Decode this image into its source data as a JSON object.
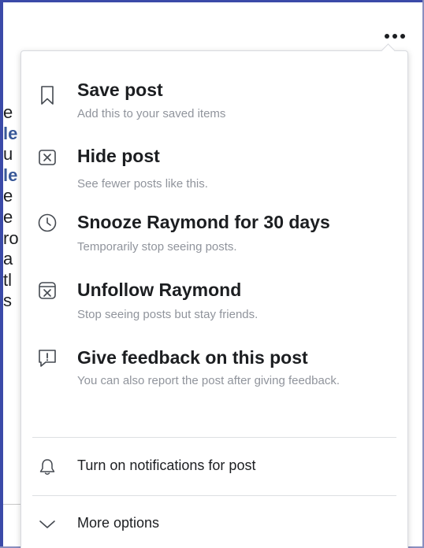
{
  "background_fragments": [
    "e",
    "le",
    "u",
    "le",
    "e",
    "e",
    "ro",
    "a",
    "tl",
    "s"
  ],
  "menu": {
    "items": [
      {
        "title": "Save post",
        "subtitle": "Add this to your saved items",
        "icon": "bookmark-icon"
      },
      {
        "title": "Hide post",
        "subtitle": "See fewer posts like this.",
        "icon": "close-box-icon"
      },
      {
        "title": "Snooze Raymond for 30 days",
        "subtitle": "Temporarily stop seeing posts.",
        "icon": "clock-icon"
      },
      {
        "title": "Unfollow Raymond",
        "subtitle": "Stop seeing posts but stay friends.",
        "icon": "unfollow-icon"
      },
      {
        "title": "Give feedback on this post",
        "subtitle": "You can also report the post after giving feedback.",
        "icon": "feedback-icon"
      }
    ],
    "notifications_label": "Turn on notifications for post",
    "more_options_label": "More options"
  },
  "colors": {
    "title": "#1c1e21",
    "subtitle": "#90949c",
    "frame": "#3b4aa8",
    "link": "#385898"
  }
}
